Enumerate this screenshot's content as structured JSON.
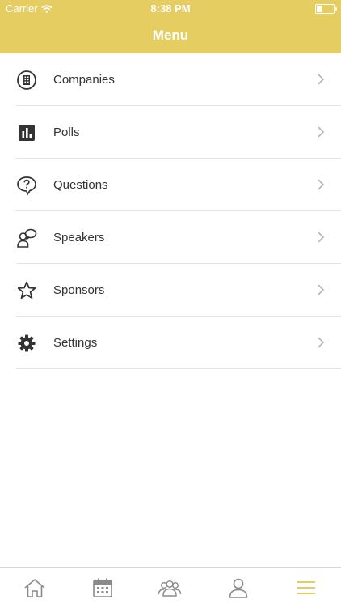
{
  "status_bar": {
    "carrier": "Carrier",
    "time": "8:38 PM",
    "battery_level": 0.3
  },
  "header": {
    "title": "Menu"
  },
  "menu": {
    "items": [
      {
        "label": "Companies",
        "icon": "building-icon"
      },
      {
        "label": "Polls",
        "icon": "bar-chart-icon"
      },
      {
        "label": "Questions",
        "icon": "question-bubble-icon"
      },
      {
        "label": "Speakers",
        "icon": "speaker-icon"
      },
      {
        "label": "Sponsors",
        "icon": "star-icon"
      },
      {
        "label": "Settings",
        "icon": "gear-icon"
      }
    ]
  },
  "tab_bar": {
    "tabs": [
      {
        "icon": "home-icon"
      },
      {
        "icon": "calendar-icon"
      },
      {
        "icon": "people-icon"
      },
      {
        "icon": "profile-icon"
      },
      {
        "icon": "hamburger-icon",
        "active": true
      }
    ],
    "active_color": "#e6cd62",
    "inactive_color": "#8a8a8a"
  },
  "colors": {
    "accent": "#e6cd62",
    "text": "#333333",
    "separator": "#e4e4e4"
  }
}
